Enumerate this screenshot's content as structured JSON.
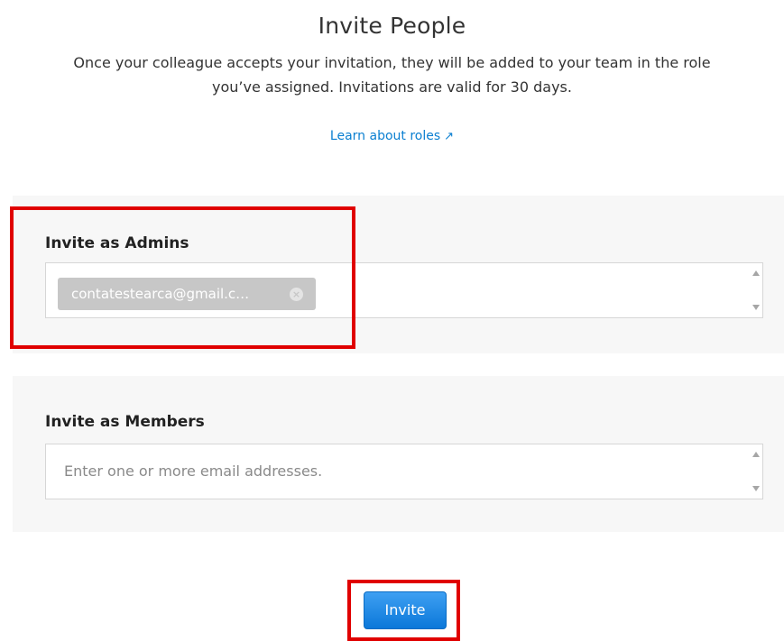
{
  "header": {
    "title": "Invite People",
    "description": "Once your colleague accepts your invitation, they will be added to your team in the role you’ve assigned. Invitations are valid for 30 days.",
    "learn_link": "Learn about roles",
    "learn_link_icon": "↗"
  },
  "admins": {
    "title": "Invite as Admins",
    "chips": [
      "contatestearca@gmail.c…"
    ],
    "chip_close_icon": "×"
  },
  "members": {
    "title": "Invite as Members",
    "placeholder": "Enter one or more email addresses."
  },
  "actions": {
    "invite_label": "Invite"
  },
  "colors": {
    "accent": "#0a7fd1",
    "highlight": "#e00000",
    "panel_bg": "#f7f7f7",
    "chip_bg": "#c7c7c7"
  }
}
